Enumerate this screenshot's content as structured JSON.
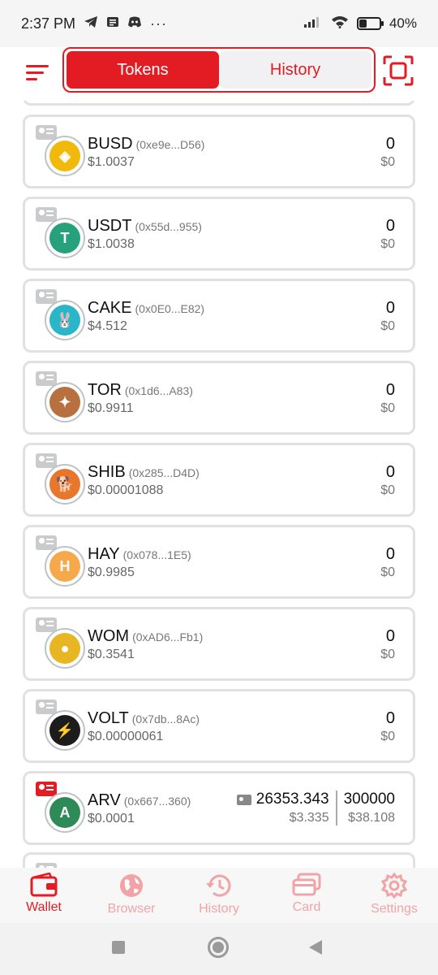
{
  "status_bar": {
    "time": "2:37 PM",
    "notification_icons": [
      "telegram-icon",
      "news-icon",
      "discord-icon"
    ],
    "more": "···",
    "battery": "40%",
    "battery_level": 0.4
  },
  "header": {
    "tabs": [
      {
        "label": "Tokens",
        "active": true
      },
      {
        "label": "History",
        "active": false
      }
    ]
  },
  "tokens": [
    {
      "symbol": "BUSD",
      "address": "(0xe9e...D56)",
      "price": "$1.0037",
      "balance": "0",
      "value": "$0",
      "logo_color": "#f0b90b",
      "logo_glyph": "◈"
    },
    {
      "symbol": "USDT",
      "address": "(0x55d...955)",
      "price": "$1.0038",
      "balance": "0",
      "value": "$0",
      "logo_color": "#26a17b",
      "logo_glyph": "T"
    },
    {
      "symbol": "CAKE",
      "address": "(0x0E0...E82)",
      "price": "$4.512",
      "balance": "0",
      "value": "$0",
      "logo_color": "#29b6c8",
      "logo_glyph": "🐰"
    },
    {
      "symbol": "TOR",
      "address": "(0x1d6...A83)",
      "price": "$0.9911",
      "balance": "0",
      "value": "$0",
      "logo_color": "#b9703f",
      "logo_glyph": "✦"
    },
    {
      "symbol": "SHIB",
      "address": "(0x285...D4D)",
      "price": "$0.00001088",
      "balance": "0",
      "value": "$0",
      "logo_color": "#e8772e",
      "logo_glyph": "🐕"
    },
    {
      "symbol": "HAY",
      "address": "(0x078...1E5)",
      "price": "$0.9985",
      "balance": "0",
      "value": "$0",
      "logo_color": "#f6a94a",
      "logo_glyph": "H"
    },
    {
      "symbol": "WOM",
      "address": "(0xAD6...Fb1)",
      "price": "$0.3541",
      "balance": "0",
      "value": "$0",
      "logo_color": "#e7b622",
      "logo_glyph": "●"
    },
    {
      "symbol": "VOLT",
      "address": "(0x7db...8Ac)",
      "price": "$0.00000061",
      "balance": "0",
      "value": "$0",
      "logo_color": "#1c1c1c",
      "logo_glyph": "⚡"
    }
  ],
  "arv": {
    "symbol": "ARV",
    "address": "(0x667...360)",
    "price": "$0.0001",
    "balance_primary": "26353.343",
    "value_primary": "$3.335",
    "balance_secondary": "300000",
    "value_secondary": "$38.108",
    "logo_color": "#2e8b57",
    "logo_glyph": "A"
  },
  "bottom_nav": [
    {
      "label": "Wallet",
      "icon": "wallet-icon",
      "active": true
    },
    {
      "label": "Browser",
      "icon": "globe-icon",
      "active": false
    },
    {
      "label": "History",
      "icon": "clock-history-icon",
      "active": false
    },
    {
      "label": "Card",
      "icon": "card-icon",
      "active": false
    },
    {
      "label": "Settings",
      "icon": "gear-icon",
      "active": false
    }
  ],
  "colors": {
    "accent": "#e31b23",
    "accent_light": "#f2a3a6",
    "card_border": "#dfe1e3"
  }
}
